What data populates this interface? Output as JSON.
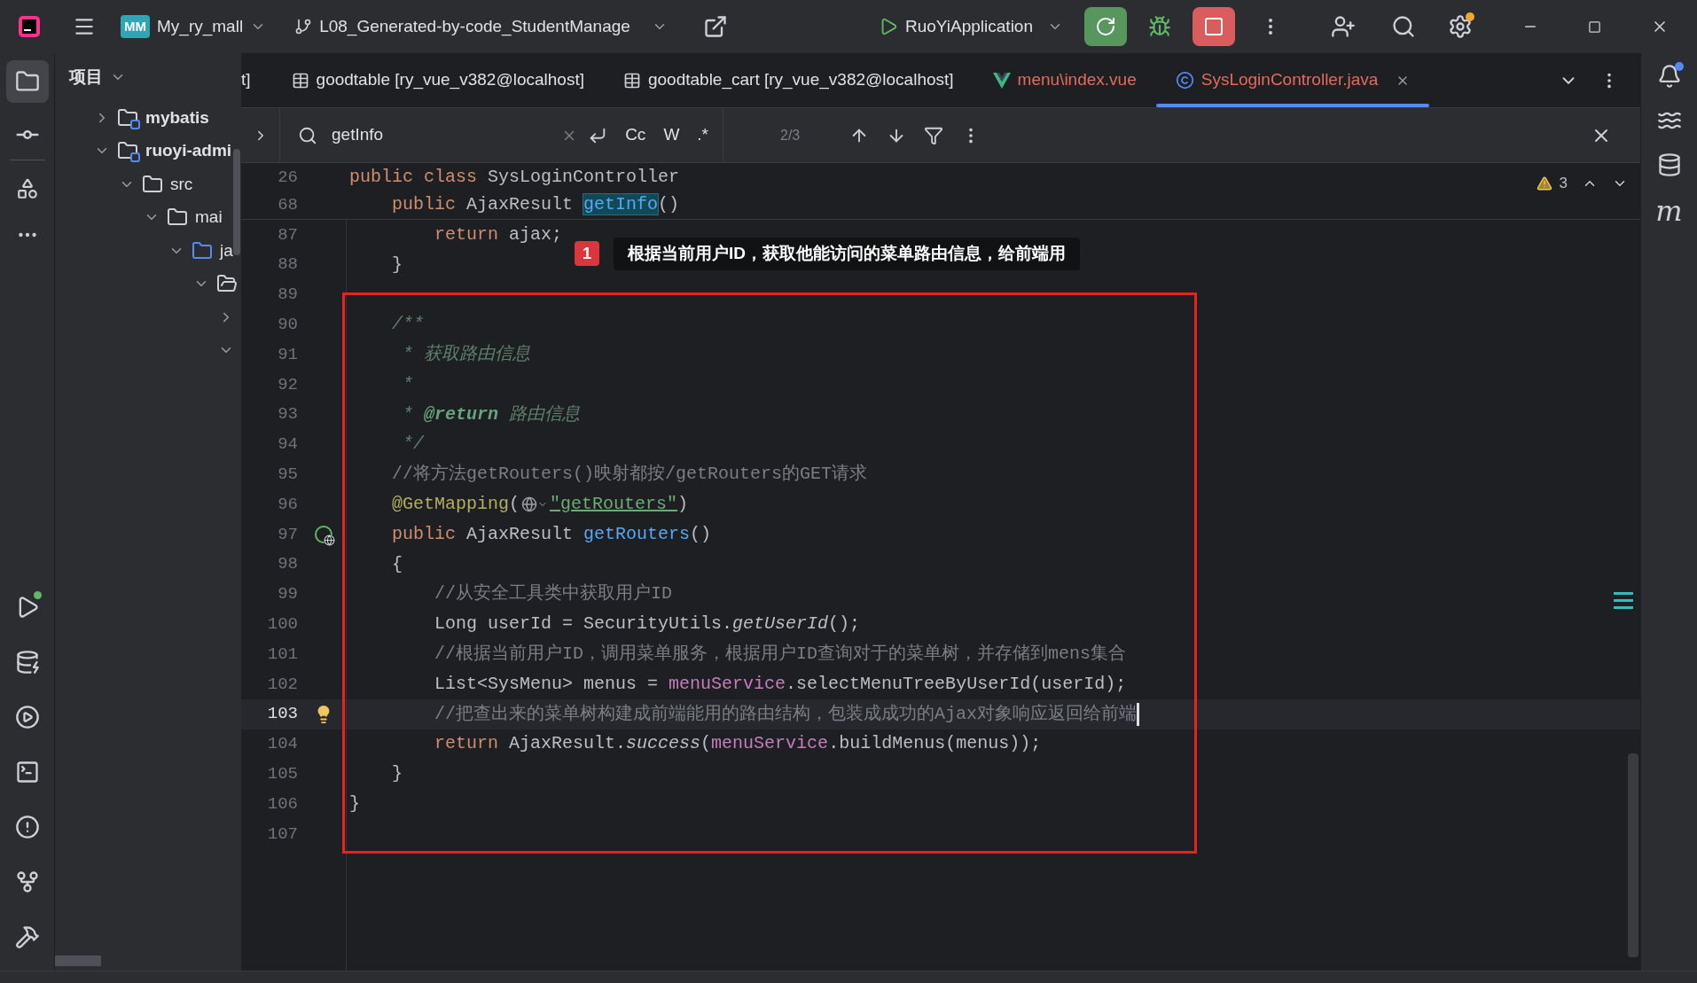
{
  "title_bar": {
    "project": {
      "badge": "MM",
      "name": "My_ry_mall"
    },
    "branch": "L08_Generated-by-code_StudentManage",
    "run_config": "RuoYiApplication"
  },
  "project_panel": {
    "title": "项目",
    "tree": [
      {
        "label": "mybatis",
        "kind": "module",
        "expanded": false
      },
      {
        "label": "ruoyi-admi",
        "kind": "module",
        "expanded": true,
        "children": [
          {
            "label": "src",
            "kind": "folder",
            "expanded": true,
            "children": [
              {
                "label": "mai",
                "kind": "folder",
                "expanded": true,
                "children": [
                  {
                    "label": "ja",
                    "kind": "source",
                    "expanded": true,
                    "children": [
                      {
                        "kind": "package",
                        "expanded": true,
                        "children": [
                          {
                            "expanded": false
                          },
                          {
                            "expanded": true
                          }
                        ]
                      }
                    ]
                  }
                ]
              }
            ]
          }
        ]
      }
    ]
  },
  "tabs": [
    {
      "label": "t]",
      "kind": "cut",
      "selected": false,
      "error": false
    },
    {
      "label": "goodtable [ry_vue_v382@localhost]",
      "kind": "table",
      "selected": false,
      "error": false
    },
    {
      "label": "goodtable_cart [ry_vue_v382@localhost]",
      "kind": "table",
      "selected": false,
      "error": false
    },
    {
      "label": "menu\\index.vue",
      "kind": "vue",
      "selected": false,
      "error": true
    },
    {
      "label": "SysLoginController.java",
      "kind": "java",
      "selected": true,
      "error": true
    }
  ],
  "find_bar": {
    "value": "getInfo",
    "options": [
      {
        "label": "Cc",
        "selected": false
      },
      {
        "label": "W",
        "selected": false
      },
      {
        "label": ".*",
        "selected": false
      }
    ],
    "count": "2/3"
  },
  "editor": {
    "warnings": "3",
    "sticky_lines": [
      {
        "number": "26",
        "tokens": [
          {
            "text": "public class ",
            "kind": "keyword"
          },
          {
            "text": "SysLoginController",
            "kind": "plain"
          }
        ]
      },
      {
        "number": "68",
        "tokens": [
          {
            "text": "    public ",
            "kind": "keyword"
          },
          {
            "text": "AjaxResult ",
            "kind": "plain"
          },
          {
            "text": "getInfo",
            "kind": "match"
          },
          {
            "text": "()",
            "kind": "plain"
          }
        ]
      }
    ],
    "lines": [
      {
        "number": "87",
        "tokens": [
          {
            "text": "        return ",
            "kind": "keyword"
          },
          {
            "text": "ajax;",
            "kind": "plain"
          }
        ]
      },
      {
        "number": "88",
        "tokens": [
          {
            "text": "    }",
            "kind": "plain"
          }
        ]
      },
      {
        "number": "89"
      },
      {
        "number": "90",
        "tokens": [
          {
            "text": "    /**",
            "kind": "doc"
          }
        ]
      },
      {
        "number": "91",
        "tokens": [
          {
            "text": "     * 获取路由信息",
            "kind": "doc"
          }
        ]
      },
      {
        "number": "92",
        "tokens": [
          {
            "text": "     *",
            "kind": "doc"
          }
        ]
      },
      {
        "number": "93",
        "tokens": [
          {
            "text": "     * ",
            "kind": "doc"
          },
          {
            "text": "@return",
            "kind": "doctag"
          },
          {
            "text": " 路由信息",
            "kind": "doc"
          }
        ]
      },
      {
        "number": "94",
        "tokens": [
          {
            "text": "     */",
            "kind": "doc"
          }
        ]
      },
      {
        "number": "95",
        "tokens": [
          {
            "text": "    //将方法getRouters()映射都按/getRouters的GET请求",
            "kind": "comment"
          }
        ]
      },
      {
        "number": "96",
        "tokens": [
          {
            "text": "    @GetMapping",
            "kind": "annotation"
          },
          {
            "text": "(",
            "kind": "plain"
          },
          {
            "kind": "globe"
          },
          {
            "text": "\"getRouters\"",
            "kind": "string"
          },
          {
            "text": ")",
            "kind": "plain"
          }
        ]
      },
      {
        "number": "97",
        "endpoint_icon": true,
        "tokens": [
          {
            "text": "    public ",
            "kind": "keyword"
          },
          {
            "text": "AjaxResult ",
            "kind": "plain"
          },
          {
            "text": "getRouters",
            "kind": "decl"
          },
          {
            "text": "()",
            "kind": "plain"
          }
        ]
      },
      {
        "number": "98",
        "tokens": [
          {
            "text": "    {",
            "kind": "plain"
          }
        ]
      },
      {
        "number": "99",
        "tokens": [
          {
            "text": "        //从安全工具类中获取用户ID",
            "kind": "comment"
          }
        ]
      },
      {
        "number": "100",
        "tokens": [
          {
            "text": "        Long userId = SecurityUtils.",
            "kind": "plain"
          },
          {
            "text": "getUserId",
            "kind": "italic"
          },
          {
            "text": "();",
            "kind": "plain"
          }
        ]
      },
      {
        "number": "101",
        "tokens": [
          {
            "text": "        //根据当前用户ID，调用菜单服务，根据用户ID查询对于的菜单树，并存储到mens集合",
            "kind": "comment"
          }
        ]
      },
      {
        "number": "102",
        "tokens": [
          {
            "text": "        List<SysMenu> menus = ",
            "kind": "plain"
          },
          {
            "text": "menuService",
            "kind": "field"
          },
          {
            "text": ".selectMenuTreeByUserId(userId);",
            "kind": "plain"
          }
        ]
      },
      {
        "number": "103",
        "current": true,
        "bulb_icon": true,
        "tokens": [
          {
            "text": "        //把查出来的菜单树构建成前端能用的路由结构，包装成成功的Ajax对象响应返回给前端",
            "kind": "comment"
          }
        ]
      },
      {
        "number": "104",
        "tokens": [
          {
            "text": "        return ",
            "kind": "keyword"
          },
          {
            "text": "AjaxResult.",
            "kind": "plain"
          },
          {
            "text": "success",
            "kind": "italic"
          },
          {
            "text": "(",
            "kind": "plain"
          },
          {
            "text": "menuService",
            "kind": "field"
          },
          {
            "text": ".buildMenus(menus));",
            "kind": "plain"
          }
        ]
      },
      {
        "number": "105",
        "tokens": [
          {
            "text": "    }",
            "kind": "plain"
          }
        ]
      },
      {
        "number": "106",
        "tokens": [
          {
            "text": "}",
            "kind": "plain"
          }
        ]
      },
      {
        "number": "107"
      }
    ],
    "callout": {
      "number": "1",
      "text": "根据当前用户ID，获取他能访问的菜单路由信息，给前端用"
    }
  },
  "right_toolbar": {
    "maven_label": "m"
  }
}
